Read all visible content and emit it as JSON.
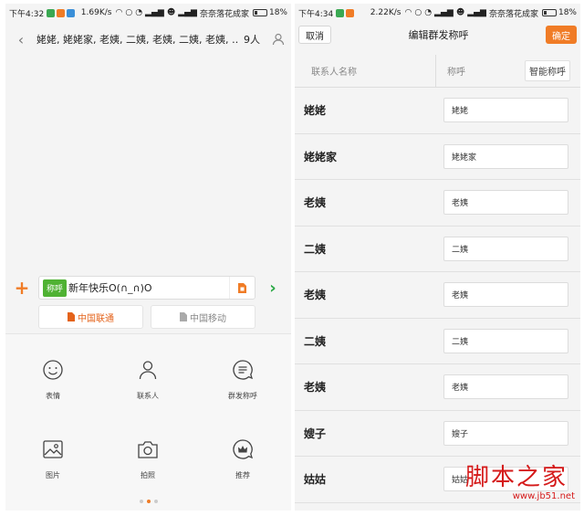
{
  "left": {
    "status": {
      "time": "下午4:32",
      "speed": "1.69K/s",
      "carrier": "奈奈落花成家",
      "battery": "18%"
    },
    "header": {
      "title": "姥姥, 姥姥家, 老姨, 二姨, 老姨, 二姨, 老姨, …",
      "count": "9人"
    },
    "compose": {
      "tag": "称呼",
      "message": "新年快乐O(∩_∩)O"
    },
    "sims": [
      {
        "label": "中国联通"
      },
      {
        "label": "中国移动"
      }
    ],
    "panel": {
      "items": [
        {
          "label": "表情",
          "icon": "smiley-icon"
        },
        {
          "label": "联系人",
          "icon": "person-icon"
        },
        {
          "label": "群发称呼",
          "icon": "group-chat-icon"
        },
        {
          "label": "图片",
          "icon": "image-icon"
        },
        {
          "label": "拍照",
          "icon": "camera-icon"
        },
        {
          "label": "推荐",
          "icon": "crown-icon"
        }
      ]
    }
  },
  "right": {
    "status": {
      "time": "下午4:34",
      "speed": "2.22K/s",
      "carrier": "奈奈落花成家",
      "battery": "18%"
    },
    "header": {
      "cancel": "取消",
      "title": "编辑群发称呼",
      "ok": "确定"
    },
    "columns": {
      "name": "联系人名称",
      "alias": "称呼",
      "smart": "智能称呼"
    },
    "contacts": [
      {
        "name": "姥姥",
        "alias": "姥姥"
      },
      {
        "name": "姥姥家",
        "alias": "姥姥家"
      },
      {
        "name": "老姨",
        "alias": "老姨"
      },
      {
        "name": "二姨",
        "alias": "二姨"
      },
      {
        "name": "老姨",
        "alias": "老姨"
      },
      {
        "name": "二姨",
        "alias": "二姨"
      },
      {
        "name": "老姨",
        "alias": "老姨"
      },
      {
        "name": "嫂子",
        "alias": "嫂子"
      },
      {
        "name": "姑姑",
        "alias": "姑姑"
      }
    ]
  },
  "watermark": {
    "text": "脚本之家",
    "url": "www.jb51.net"
  },
  "colors": {
    "accent": "#f07c26",
    "green": "#4fb233",
    "send": "#2aa845",
    "watermark": "#d51a1a"
  }
}
